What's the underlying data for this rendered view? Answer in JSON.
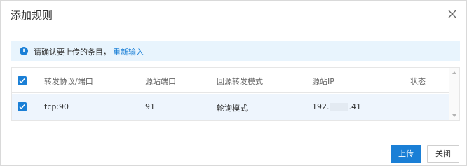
{
  "dialog": {
    "title": "添加规则",
    "close_icon": "close-icon"
  },
  "notice": {
    "icon": "info-icon",
    "icon_glyph": "i",
    "message": "请确认要上传的条目，",
    "link": "重新输入"
  },
  "table": {
    "columns": [
      "转发协议/端口",
      "源站端口",
      "回源转发模式",
      "源站IP",
      "状态"
    ],
    "rows": [
      {
        "checked": true,
        "protocol_port": "tcp:90",
        "origin_port": "91",
        "mode": "轮询模式",
        "ip_prefix": "192.",
        "ip_suffix": ".41",
        "status": ""
      }
    ]
  },
  "footer": {
    "upload_label": "上传",
    "close_label": "关闭"
  },
  "colors": {
    "accent": "#1a7fd6",
    "notice_bg": "#e8f4fd",
    "row_selected_bg": "#eef5fd"
  }
}
